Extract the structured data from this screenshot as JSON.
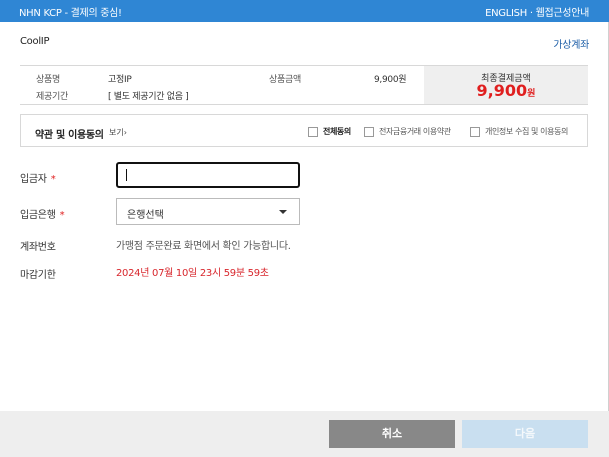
{
  "topbar": {
    "title": "NHN KCP - 결제의 중심!",
    "english_link": "ENGLISH",
    "separator": "·",
    "guide_link": "웹접근성안내"
  },
  "merchant": {
    "name": "CoolIP"
  },
  "pay_method": {
    "label": "가상계좌"
  },
  "product": {
    "name_label": "상품명",
    "name_value": "고정IP",
    "period_label": "제공기간",
    "period_value": "[ 별도 제공기간 없음 ]",
    "amount_label": "상품금액",
    "amount_value": "9,900원",
    "total_label": "최종결제금액",
    "total_value": "9,900",
    "total_unit": "원"
  },
  "terms": {
    "heading": "약관 및 이용동의",
    "more": "보기›",
    "agree_all": "전체동의",
    "finance_terms": "전자금융거래 이용약관",
    "privacy_terms": "개인정보 수집 및 이용동의"
  },
  "form": {
    "depositor_label": "입금자",
    "required_mark": "*",
    "depositor_value": "",
    "bank_label": "입금은행",
    "bank_selected": "은행선택",
    "account_label": "계좌번호",
    "account_value": "가맹점 주문완료 화면에서 확인 가능합니다.",
    "deadline_label": "마감기한",
    "deadline_value": "2024년 07월 10일 23시 59분 59초"
  },
  "buttons": {
    "cancel": "취소",
    "next": "다음"
  },
  "colors": {
    "brand_blue": "#2f86d4",
    "total_red": "#e01f1f",
    "deadline_red": "#d8262c"
  }
}
